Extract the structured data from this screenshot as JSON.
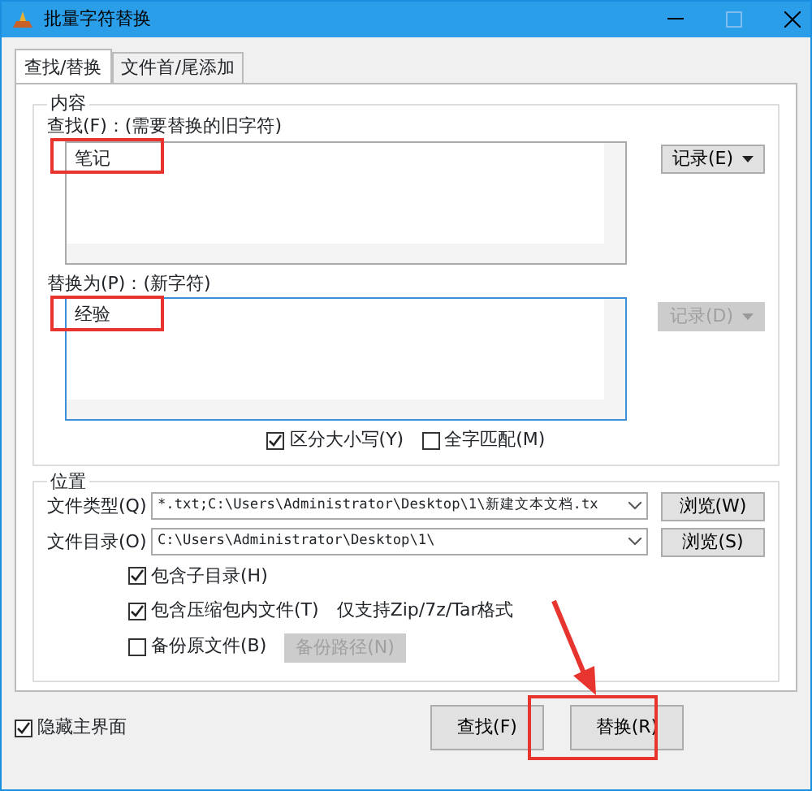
{
  "window": {
    "title": "批量字符替换"
  },
  "tabs": [
    {
      "label": "查找/替换",
      "selected": true
    },
    {
      "label": "文件首/尾添加",
      "selected": false
    }
  ],
  "content_group": {
    "title": "内容",
    "find": {
      "label": "查找(F)：(需要替换的旧字符)",
      "value": "笔记",
      "history_button": {
        "label": "记录(E)",
        "disabled": false
      }
    },
    "replace": {
      "label": "替换为(P)：(新字符)",
      "value": "经验",
      "history_button": {
        "label": "记录(D)",
        "disabled": true
      }
    },
    "options": [
      {
        "label": "区分大小写(Y)",
        "checked": true
      },
      {
        "label": "全字匹配(M)",
        "checked": false
      }
    ]
  },
  "location_group": {
    "title": "位置",
    "fields": [
      {
        "label": "文件类型(Q)",
        "value": "*.txt;C:\\Users\\Administrator\\Desktop\\1\\新建文本文档.tx",
        "button": "浏览(W)"
      },
      {
        "label": "文件目录(O)",
        "value": "C:\\Users\\Administrator\\Desktop\\1\\",
        "button": "浏览(S)"
      }
    ],
    "options": [
      {
        "label": "包含子目录(H)",
        "checked": true
      },
      {
        "label": "包含压缩包内文件(T)",
        "note": "仅支持Zip/7z/Tar格式",
        "checked": true
      },
      {
        "label": "备份原文件(B)",
        "checked": false,
        "button": {
          "label": "备份路径(N)",
          "disabled": true
        }
      }
    ]
  },
  "footer": {
    "hide_main": {
      "label": "隐藏主界面",
      "checked": true
    },
    "buttons": [
      "查找(F)",
      "替换(R)"
    ]
  }
}
